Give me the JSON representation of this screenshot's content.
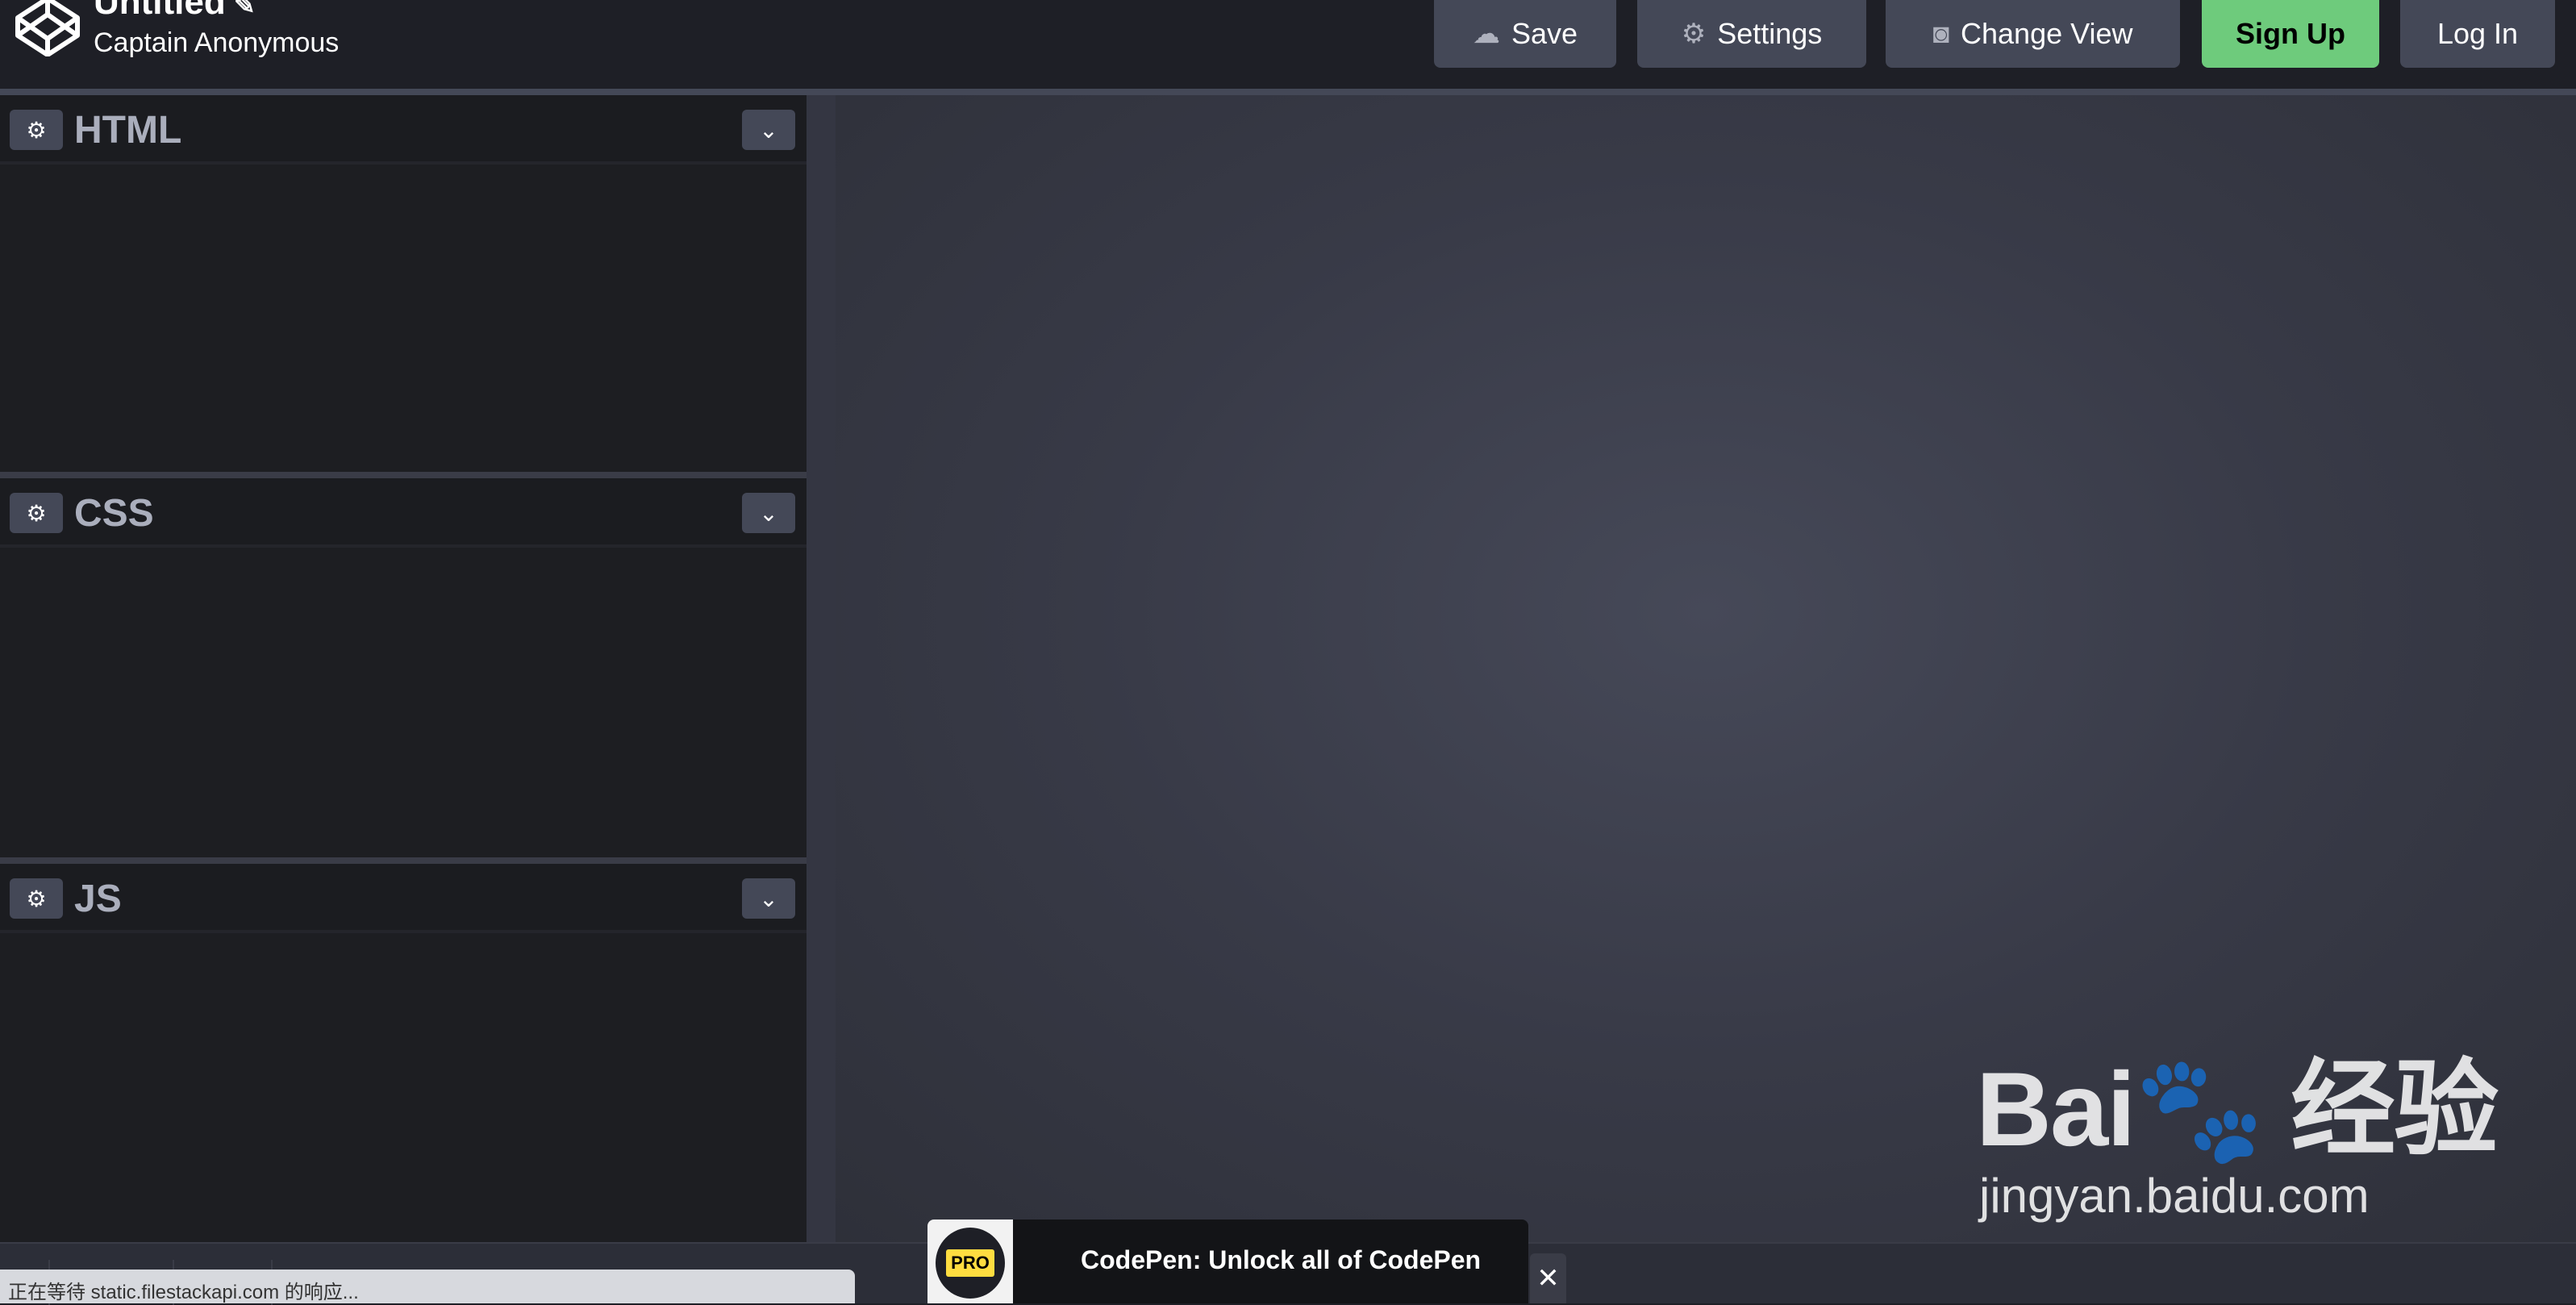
{
  "header": {
    "title": "Untitled",
    "author": "Captain Anonymous",
    "buttons": {
      "save": "Save",
      "settings": "Settings",
      "change_view": "Change View",
      "sign_up": "Sign Up",
      "log_in": "Log In"
    }
  },
  "editors": [
    {
      "label": "HTML"
    },
    {
      "label": "CSS"
    },
    {
      "label": "JS"
    }
  ],
  "status_bar": "正在等待 static.filestackapi.com 的响应...",
  "toast": {
    "badge": "PRO",
    "message": "CodePen: Unlock all of CodePen",
    "close": "✕"
  },
  "watermark": {
    "brand": "Bai du 经验",
    "url": "jingyan.baidu.com"
  },
  "colors": {
    "accent_green": "#6ecb7c",
    "button_bg": "#444857",
    "pro_yellow": "#ffdd40"
  }
}
